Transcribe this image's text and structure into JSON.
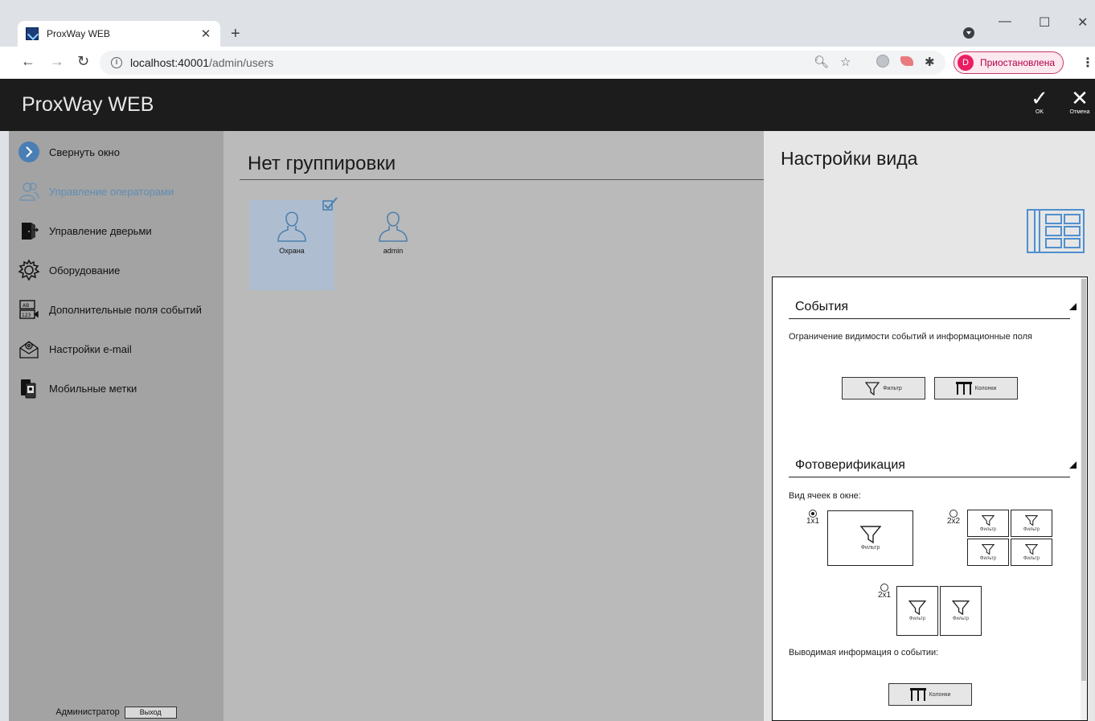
{
  "browser": {
    "tab_title": "ProxWay WEB",
    "tab_close": "✕",
    "new_tab": "+",
    "url_host": "localhost:40001",
    "url_path": "/admin/users",
    "profile_initial": "D",
    "profile_status": "Приостановлена",
    "window_controls": {
      "minimize": "—",
      "maximize": "☐",
      "close": "✕"
    }
  },
  "header": {
    "title": "ProxWay WEB",
    "ok_label": "OK",
    "cancel_label": "Отмена"
  },
  "sidebar": {
    "items": [
      {
        "label": "Свернуть окно",
        "icon": "collapse-arrow-icon",
        "active": false
      },
      {
        "label": "Управление операторами",
        "icon": "operators-icon",
        "active": true
      },
      {
        "label": "Управление дверьми",
        "icon": "door-icon",
        "active": false
      },
      {
        "label": "Оборудование",
        "icon": "gear-icon",
        "active": false
      },
      {
        "label": "Дополнительные поля событий",
        "icon": "event-fields-icon",
        "active": false
      },
      {
        "label": "Настройки e-mail",
        "icon": "email-icon",
        "active": false
      },
      {
        "label": "Мобильные метки",
        "icon": "mobile-tag-icon",
        "active": false
      }
    ],
    "footer": {
      "user": "Администратор",
      "logout": "Выход"
    }
  },
  "main": {
    "group_title": "Нет группировки",
    "users": [
      {
        "name": "Охрана",
        "selected": true
      },
      {
        "name": "admin",
        "selected": false
      }
    ]
  },
  "panel": {
    "title": "Настройки вида",
    "events": {
      "title": "События",
      "description": "Ограничение видимости событий и информационные поля",
      "filter_label": "Фильтр",
      "columns_label": "Колонки"
    },
    "photo": {
      "title": "Фотоверификация",
      "cells_label": "Вид ячеек в окне:",
      "options": [
        {
          "label": "1x1",
          "selected": true
        },
        {
          "label": "2x2",
          "selected": false
        },
        {
          "label": "2x1",
          "selected": false
        }
      ],
      "cell_caption": "Фильтр",
      "event_info_label": "Выводимая информация о событии:",
      "columns_label": "Колонки"
    }
  },
  "colors": {
    "header_bg": "#1c1c1c",
    "sidebar_bg": "#a3a3a3",
    "main_bg": "#bababa",
    "panel_bg": "#e6e6e6",
    "accent": "#5e8db5",
    "selected_card": "#aebed0"
  }
}
